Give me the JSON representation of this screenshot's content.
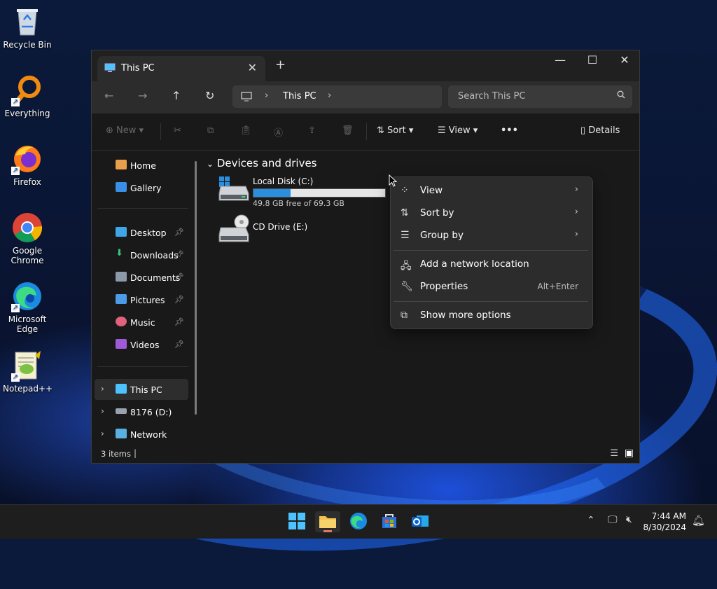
{
  "desktop": {
    "icons": [
      {
        "label": "Recycle Bin"
      },
      {
        "label": "Everything"
      },
      {
        "label": "Firefox"
      },
      {
        "label": "Google Chrome"
      },
      {
        "label": "Microsoft Edge"
      },
      {
        "label": "Notepad++"
      }
    ]
  },
  "window": {
    "tab_title": "This PC",
    "tab_close": "✕",
    "new_tab": "+",
    "minimize": "—",
    "maximize": "☐",
    "close": "✕"
  },
  "nav": {
    "back": "←",
    "forward": "→",
    "up": "↑",
    "refresh": "↻",
    "breadcrumb": "This PC",
    "search_placeholder": "Search This PC"
  },
  "toolbar": {
    "new_label": "New",
    "sort_label": "Sort",
    "view_label": "View",
    "more_label": "•••",
    "details_label": "Details"
  },
  "sidebar": {
    "items": [
      {
        "label": "Home"
      },
      {
        "label": "Gallery"
      },
      {
        "label": "Desktop"
      },
      {
        "label": "Downloads"
      },
      {
        "label": "Documents"
      },
      {
        "label": "Pictures"
      },
      {
        "label": "Music"
      },
      {
        "label": "Videos"
      },
      {
        "label": "This PC"
      },
      {
        "label": "8176 (D:)"
      },
      {
        "label": "Network"
      }
    ]
  },
  "main": {
    "group_title": "Devices and drives",
    "drives": [
      {
        "name": "Local Disk (C:)",
        "free": "49.8 GB free of 69.3 GB",
        "used_fraction": 0.28
      },
      {
        "name": "CD Drive (E:)"
      }
    ]
  },
  "status": {
    "items_count": "3 items"
  },
  "context_menu": {
    "items": [
      {
        "label": "View"
      },
      {
        "label": "Sort by"
      },
      {
        "label": "Group by"
      },
      {
        "label": "Add a network location"
      },
      {
        "label": "Properties",
        "shortcut": "Alt+Enter"
      },
      {
        "label": "Show more options"
      }
    ]
  },
  "taskbar": {
    "time": "7:44 AM",
    "date": "8/30/2024"
  },
  "colors": {
    "accent": "#2b8fe0",
    "window_bg": "#191919",
    "menu_bg": "#2c2c2c"
  }
}
